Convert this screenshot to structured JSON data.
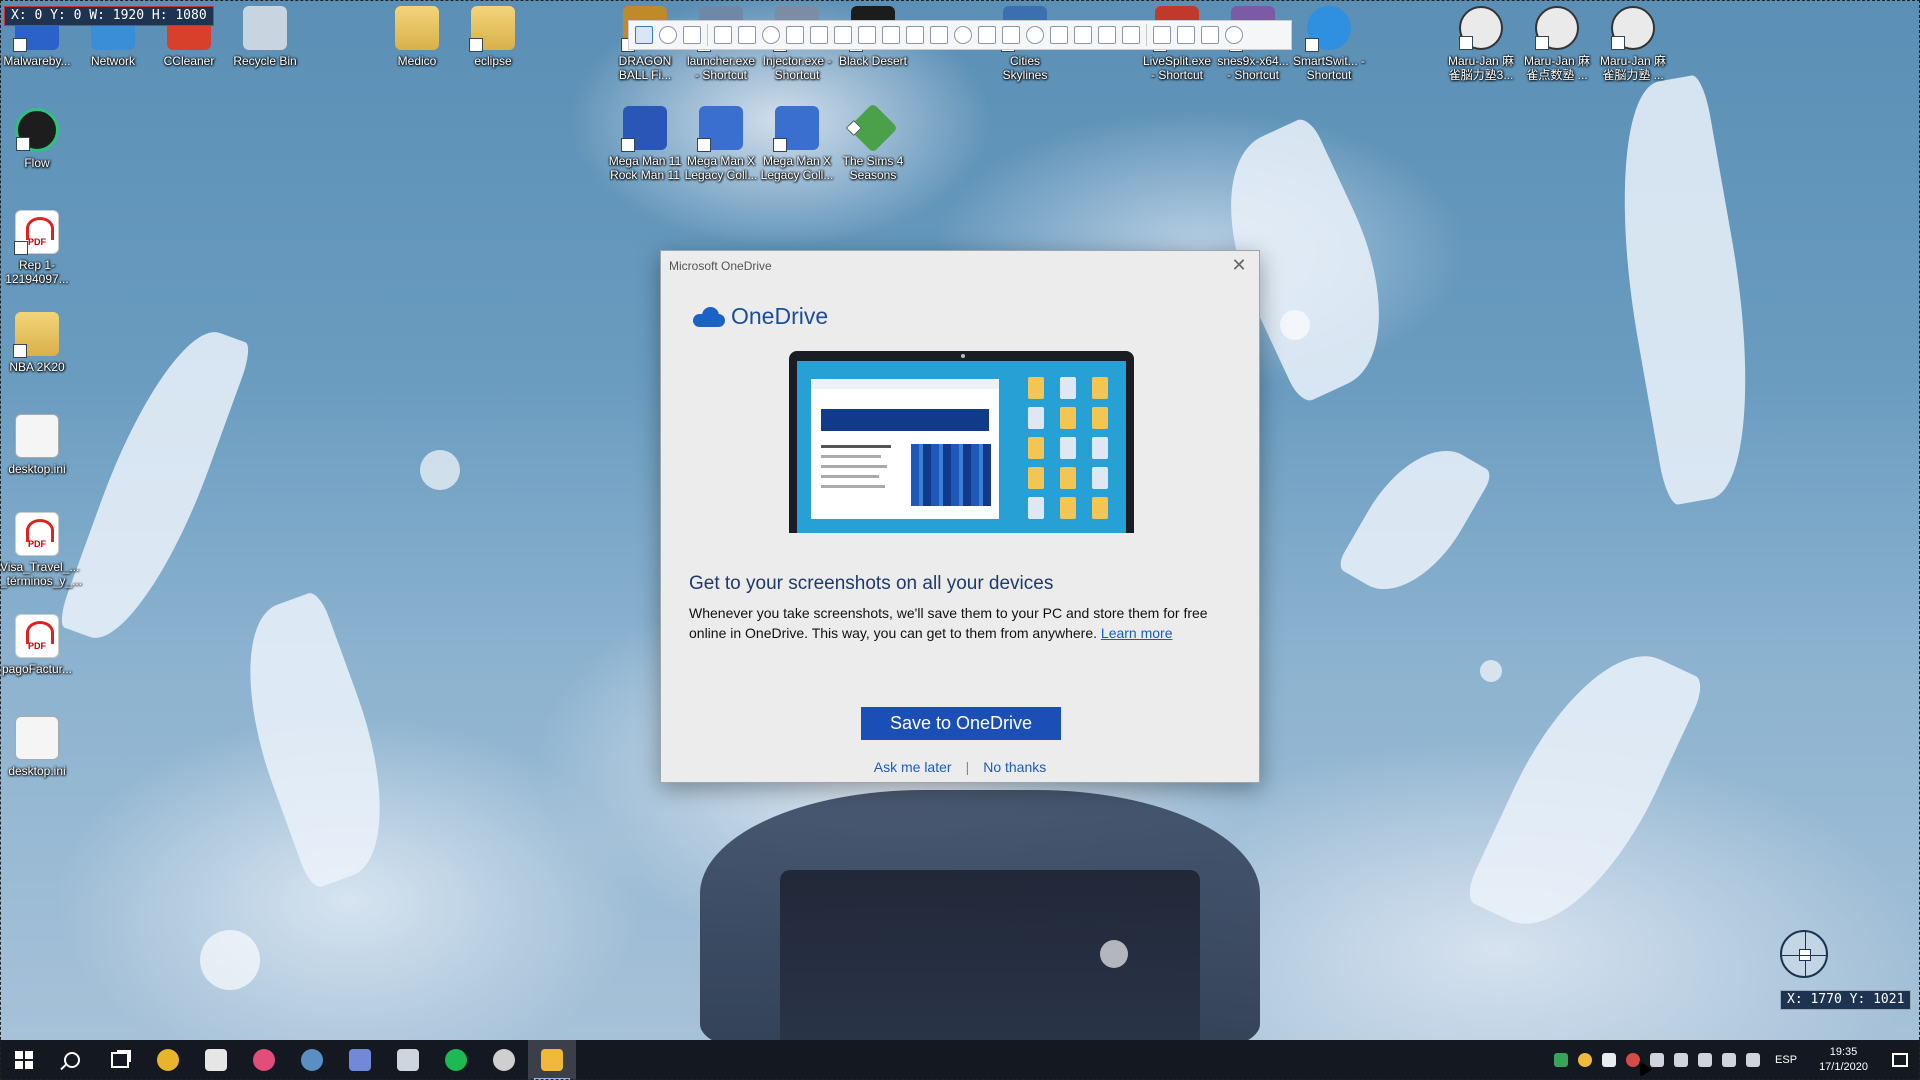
{
  "overlay": {
    "top_readout": "X: 0 Y: 0 W: 1920 H: 1080",
    "cursor_readout": "X: 1770 Y: 1021"
  },
  "desktop_icons": [
    {
      "id": "malwarebytes",
      "label": "Malwareby...",
      "icon": "malwarebytes-icon",
      "color": "#2a62c9"
    },
    {
      "id": "network",
      "label": "Network",
      "icon": "network-icon",
      "color": "#3a8ed8"
    },
    {
      "id": "ccleaner",
      "label": "CCleaner",
      "icon": "ccleaner-icon",
      "color": "#d8402c"
    },
    {
      "id": "recycle-bin",
      "label": "Recycle Bin",
      "icon": "recycle-bin-icon",
      "color": "#c8d4e0"
    },
    {
      "id": "medico",
      "label": "Medico",
      "icon": "folder-icon",
      "color": "#e8c35f"
    },
    {
      "id": "eclipse",
      "label": "eclipse",
      "icon": "folder-icon",
      "color": "#e8c35f"
    },
    {
      "id": "dragon-ball",
      "label": "DRAGON BALL Fi...",
      "icon": "game-icon",
      "color": "#c08a2a"
    },
    {
      "id": "launcher",
      "label": "launcher.exe - Shortcut",
      "icon": "app-icon",
      "color": "#6f88a8"
    },
    {
      "id": "injector",
      "label": "Injector.exe - Shortcut",
      "icon": "app-icon",
      "color": "#7c8ca4"
    },
    {
      "id": "black-desert",
      "label": "Black Desert",
      "icon": "game-icon",
      "color": "#1c1c1c"
    },
    {
      "id": "cities-skylines",
      "label": "Cities Skylines",
      "icon": "game-icon",
      "color": "#3c6fb0"
    },
    {
      "id": "livesplit",
      "label": "LiveSplit.exe - Shortcut",
      "icon": "app-icon",
      "color": "#c0392b"
    },
    {
      "id": "snes9x",
      "label": "snes9x-x64... - Shortcut",
      "icon": "app-icon",
      "color": "#7b5aa6"
    },
    {
      "id": "smartswitch",
      "label": "SmartSwit... - Shortcut",
      "icon": "smartswitch-icon",
      "color": "#2f8fe0"
    },
    {
      "id": "maru-jan-1",
      "label": "Maru-Jan 麻雀脳力塾3...",
      "icon": "mahjong-icon",
      "color": "#eaeaea"
    },
    {
      "id": "maru-jan-2",
      "label": "Maru-Jan 麻雀点数塾 ...",
      "icon": "mahjong-icon",
      "color": "#eaeaea"
    },
    {
      "id": "maru-jan-3",
      "label": "Maru-Jan 麻雀脳力塾 ...",
      "icon": "mahjong-icon",
      "color": "#eaeaea"
    },
    {
      "id": "flow",
      "label": "Flow",
      "icon": "flow-icon",
      "color": "#1d1d1d"
    },
    {
      "id": "rep-pdf",
      "label": "Rep 1-12194097...",
      "icon": "pdf-icon",
      "color": "#ffffff"
    },
    {
      "id": "nba2k20",
      "label": "NBA 2K20",
      "icon": "folder-icon",
      "color": "#e8c35f"
    },
    {
      "id": "desktop-ini-1",
      "label": "desktop.ini",
      "icon": "file-icon",
      "color": "#f2f2f2"
    },
    {
      "id": "visa-pdf",
      "label": "Visa_Travel_... _términos_y_...",
      "icon": "pdf-icon",
      "color": "#ffffff"
    },
    {
      "id": "pagofactura-pdf",
      "label": "pagoFactur...",
      "icon": "pdf-icon",
      "color": "#ffffff"
    },
    {
      "id": "desktop-ini-2",
      "label": "desktop.ini",
      "icon": "file-icon",
      "color": "#f2f2f2"
    },
    {
      "id": "megaman11",
      "label": "Mega Man 11 Rock Man 11",
      "icon": "game-icon",
      "color": "#2a56b8"
    },
    {
      "id": "megamanx-1",
      "label": "Mega Man X Legacy Coll...",
      "icon": "game-icon",
      "color": "#3a6fd0"
    },
    {
      "id": "megamanx-2",
      "label": "Mega Man X Legacy Coll...",
      "icon": "game-icon",
      "color": "#3a6fd0"
    },
    {
      "id": "sims4",
      "label": "The Sims 4 Seasons",
      "icon": "sims-icon",
      "color": "#4aa14a"
    }
  ],
  "pdf_badge": "PDF",
  "dialog": {
    "window_title": "Microsoft OneDrive",
    "close_label": "✕",
    "brand": "OneDrive",
    "heading": "Get to your screenshots on all your devices",
    "body": "Whenever you take screenshots, we'll save them to your PC and store them for free online in OneDrive. This way, you can get to them from anywhere.",
    "learn_more": "Learn more",
    "primary_button": "Save to OneDrive",
    "ask_later": "Ask me later",
    "separator": "|",
    "no_thanks": "No thanks"
  },
  "taskbar": {
    "apps": [
      {
        "name": "chrome",
        "color": "#e8b42c"
      },
      {
        "name": "wolf-app",
        "color": "#e6e6e6"
      },
      {
        "name": "slack",
        "color": "#e34d7a"
      },
      {
        "name": "steam",
        "color": "#5b8fc4"
      },
      {
        "name": "discord",
        "color": "#7289da"
      },
      {
        "name": "equalizer-app",
        "color": "#cfd5de"
      },
      {
        "name": "spotify",
        "color": "#1db954"
      },
      {
        "name": "obs",
        "color": "#cfcfcf"
      },
      {
        "name": "file-explorer",
        "color": "#f0b93a"
      }
    ],
    "tray_icons": [
      {
        "name": "security",
        "color": "#3aa35a"
      },
      {
        "name": "chrome-tray",
        "color": "#f0b93a"
      },
      {
        "name": "onedrive-tray",
        "color": "#e8edf2"
      },
      {
        "name": "sync",
        "color": "#d44c44"
      },
      {
        "name": "network-tray",
        "color": "#cfd5de"
      },
      {
        "name": "battery",
        "color": "#cfd5de"
      },
      {
        "name": "update",
        "color": "#cfd5de"
      },
      {
        "name": "display",
        "color": "#cfd5de"
      },
      {
        "name": "volume",
        "color": "#cfd5de"
      }
    ],
    "language": "ESP",
    "time": "19:35",
    "date": "17/1/2020"
  }
}
